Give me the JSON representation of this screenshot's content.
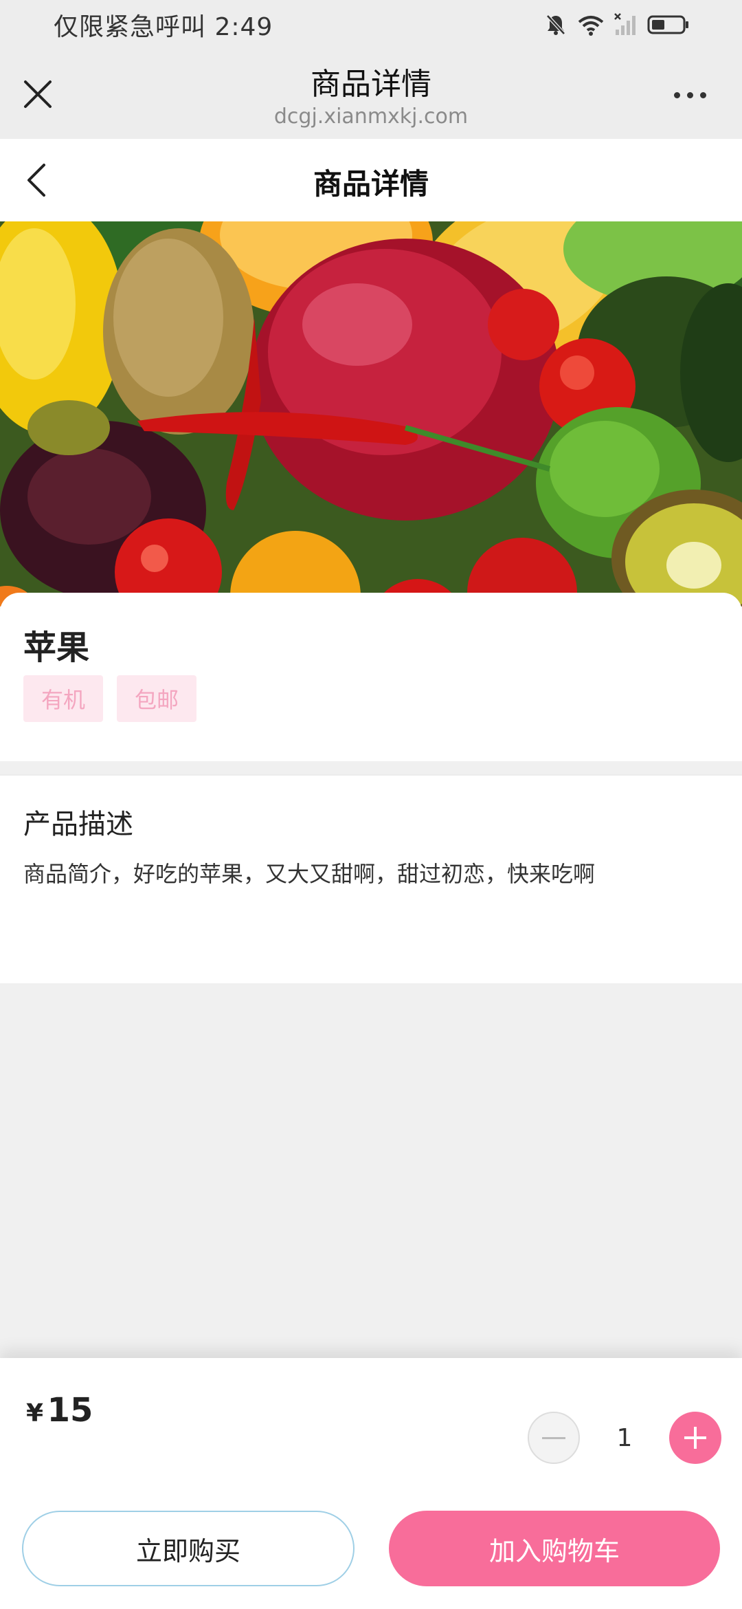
{
  "status_bar": {
    "text": "仅限紧急呼叫 2:49"
  },
  "browser": {
    "title": "商品详情",
    "url": "dcgj.xianmxkj.com"
  },
  "page": {
    "title": "商品详情"
  },
  "product": {
    "name": "苹果",
    "tags": [
      "有机",
      "包邮"
    ],
    "description_title": "产品描述",
    "description": "商品简介，好吃的苹果，又大又甜啊，甜过初恋，快来吃啊"
  },
  "purchase": {
    "currency": "¥",
    "price": "15",
    "quantity": "1",
    "buy_now_label": "立即购买",
    "add_to_cart_label": "加入购物车"
  },
  "colors": {
    "accent": "#f86d9a",
    "tag_bg": "#fde8ef",
    "tag_text": "#f4a6c0"
  }
}
